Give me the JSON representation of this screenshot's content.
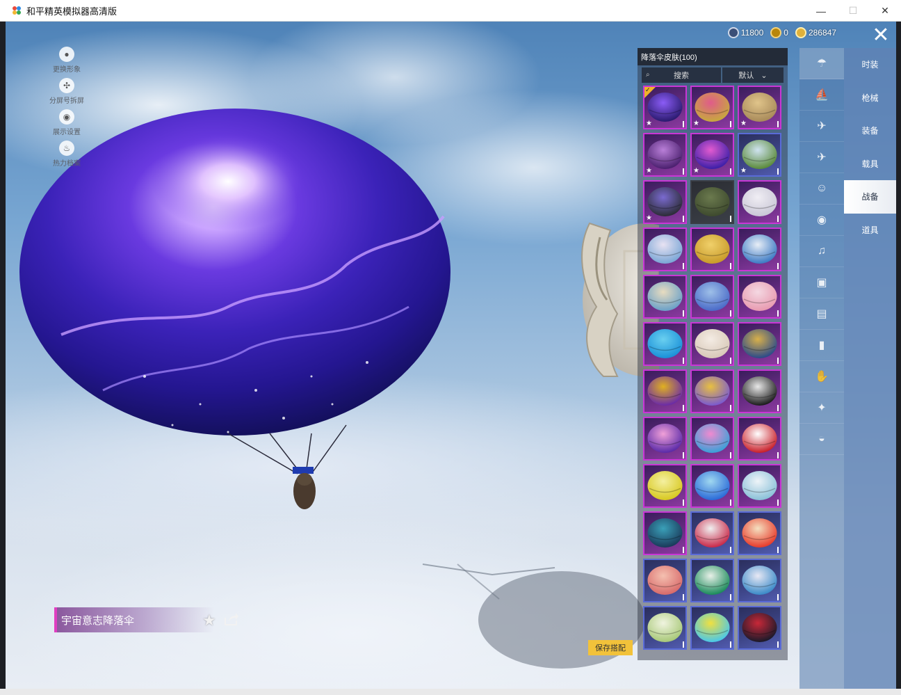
{
  "window": {
    "title": "和平精英模拟器高清版",
    "controls": {
      "minimize": "—",
      "maximize": "☐",
      "close": "✕"
    }
  },
  "side_tools": [
    {
      "label": "更换形象",
      "icon": "person-icon"
    },
    {
      "label": "分屏号拆屏",
      "icon": "split-icon"
    },
    {
      "label": "展示设置",
      "icon": "eye-icon"
    },
    {
      "label": "热力档案",
      "icon": "flame-icon"
    }
  ],
  "currency": [
    {
      "value": "11800",
      "icon": "globe-coin-icon",
      "color": "#3b4f78"
    },
    {
      "value": "0",
      "icon": "medal-coin-icon",
      "color": "#b8860b"
    },
    {
      "value": "286847",
      "icon": "gold-coin-icon",
      "color": "#e0b13a"
    }
  ],
  "panel": {
    "title": "降落伞皮肤(100)",
    "search_label": "搜索",
    "sort_label": "默认",
    "items": [
      {
        "palette": [
          "#2a1a6e",
          "#8b5cf6"
        ],
        "star": true,
        "selected": true,
        "frame": "purple"
      },
      {
        "palette": [
          "#c7a93d",
          "#e05b8a"
        ],
        "star": true,
        "selected": false,
        "frame": "purple"
      },
      {
        "palette": [
          "#a88a5a",
          "#e0c48a"
        ],
        "star": true,
        "selected": false,
        "frame": "purple"
      },
      {
        "palette": [
          "#4a1f6e",
          "#b97fd8"
        ],
        "star": true,
        "selected": false,
        "frame": "purple"
      },
      {
        "palette": [
          "#3b1fa8",
          "#e25bd0"
        ],
        "star": true,
        "selected": false,
        "frame": "purple"
      },
      {
        "palette": [
          "#5a8a3a",
          "#cfe3f0"
        ],
        "star": true,
        "selected": false,
        "frame": "blue"
      },
      {
        "palette": [
          "#2c2c36",
          "#7a6ad0"
        ],
        "star": true,
        "selected": false,
        "frame": "purple"
      },
      {
        "palette": [
          "#3e4a2e",
          "#6b7a4e"
        ],
        "star": false,
        "selected": false,
        "frame": "plain"
      },
      {
        "palette": [
          "#c9c7d6",
          "#f0eef4"
        ],
        "star": false,
        "selected": false,
        "frame": "purple"
      },
      {
        "palette": [
          "#7aa6d6",
          "#e8e2f2"
        ],
        "star": false,
        "selected": false,
        "frame": "purple"
      },
      {
        "palette": [
          "#c89a2a",
          "#f0d06a"
        ],
        "star": false,
        "selected": false,
        "frame": "purple"
      },
      {
        "palette": [
          "#3c7ac4",
          "#e8eef6"
        ],
        "star": false,
        "selected": false,
        "frame": "purple"
      },
      {
        "palette": [
          "#6aa0c8",
          "#e8dcc0"
        ],
        "star": false,
        "selected": false,
        "frame": "purple"
      },
      {
        "palette": [
          "#4a6ac8",
          "#9ec0e8"
        ],
        "star": false,
        "selected": false,
        "frame": "purple"
      },
      {
        "palette": [
          "#e89ab0",
          "#f4d8e2"
        ],
        "star": false,
        "selected": false,
        "frame": "purple"
      },
      {
        "palette": [
          "#1a90d8",
          "#6ad0f0"
        ],
        "star": false,
        "selected": false,
        "frame": "purple"
      },
      {
        "palette": [
          "#d8c8b8",
          "#f4ece4"
        ],
        "star": false,
        "selected": false,
        "frame": "purple"
      },
      {
        "palette": [
          "#2a4a8a",
          "#d8b04a"
        ],
        "star": false,
        "selected": false,
        "frame": "purple"
      },
      {
        "palette": [
          "#6a2aa8",
          "#e0b020"
        ],
        "star": false,
        "selected": false,
        "frame": "purple"
      },
      {
        "palette": [
          "#7a5ad0",
          "#e8c040"
        ],
        "star": false,
        "selected": false,
        "frame": "purple"
      },
      {
        "palette": [
          "#1a1a1a",
          "#e8e8e8"
        ],
        "star": false,
        "selected": false,
        "frame": "purple"
      },
      {
        "palette": [
          "#5a2aa8",
          "#f0a0d8"
        ],
        "star": false,
        "selected": false,
        "frame": "purple"
      },
      {
        "palette": [
          "#3aa0d8",
          "#f08ad0"
        ],
        "star": false,
        "selected": false,
        "frame": "purple"
      },
      {
        "palette": [
          "#c81e28",
          "#ffffff"
        ],
        "star": false,
        "selected": false,
        "frame": "purple"
      },
      {
        "palette": [
          "#d8c820",
          "#f4f0a0"
        ],
        "star": false,
        "selected": false,
        "frame": "purple"
      },
      {
        "palette": [
          "#2a6ad8",
          "#a0d8f0"
        ],
        "star": false,
        "selected": false,
        "frame": "purple"
      },
      {
        "palette": [
          "#8ac0d8",
          "#eef4f8"
        ],
        "star": false,
        "selected": false,
        "frame": "purple"
      },
      {
        "palette": [
          "#1a3a5a",
          "#3aa0b8"
        ],
        "star": false,
        "selected": false,
        "frame": "purple"
      },
      {
        "palette": [
          "#c82848",
          "#f0f0f0"
        ],
        "star": false,
        "selected": false,
        "frame": "blue"
      },
      {
        "palette": [
          "#e83a2a",
          "#f4e0c0"
        ],
        "star": false,
        "selected": false,
        "frame": "blue"
      },
      {
        "palette": [
          "#d86a6a",
          "#f4c0b0"
        ],
        "star": false,
        "selected": false,
        "frame": "blue"
      },
      {
        "palette": [
          "#1a8a5a",
          "#e8f0e8"
        ],
        "star": false,
        "selected": false,
        "frame": "blue"
      },
      {
        "palette": [
          "#3a8ac8",
          "#e8e8f4"
        ],
        "star": false,
        "selected": false,
        "frame": "blue"
      },
      {
        "palette": [
          "#a8c878",
          "#f0f4e0"
        ],
        "star": false,
        "selected": false,
        "frame": "blue"
      },
      {
        "palette": [
          "#4ac8e8",
          "#f0e040"
        ],
        "star": false,
        "selected": false,
        "frame": "blue"
      },
      {
        "palette": [
          "#1a1a2a",
          "#c82838"
        ],
        "star": false,
        "selected": false,
        "frame": "blue"
      }
    ]
  },
  "icon_tabs": [
    {
      "icon": "parachute-icon",
      "active": true
    },
    {
      "icon": "boat-icon",
      "active": false
    },
    {
      "icon": "drone-icon",
      "active": false
    },
    {
      "icon": "plane-icon",
      "active": false
    },
    {
      "icon": "emote-icon",
      "active": false
    },
    {
      "icon": "robot-icon",
      "active": false
    },
    {
      "icon": "speaker-icon",
      "active": false
    },
    {
      "icon": "badge-icon",
      "active": false
    },
    {
      "icon": "photo-icon",
      "active": false
    },
    {
      "icon": "extinguisher-icon",
      "active": false
    },
    {
      "icon": "hand-icon",
      "active": false
    },
    {
      "icon": "wand-icon",
      "active": false
    },
    {
      "icon": "ufo-icon",
      "active": false
    }
  ],
  "category_tabs": [
    {
      "label": "时装",
      "active": false
    },
    {
      "label": "枪械",
      "active": false
    },
    {
      "label": "装备",
      "active": false
    },
    {
      "label": "载具",
      "active": false
    },
    {
      "label": "战备",
      "active": true
    },
    {
      "label": "道具",
      "active": false
    }
  ],
  "item_name": "宇宙意志降落伞",
  "save_button": "保存搭配"
}
